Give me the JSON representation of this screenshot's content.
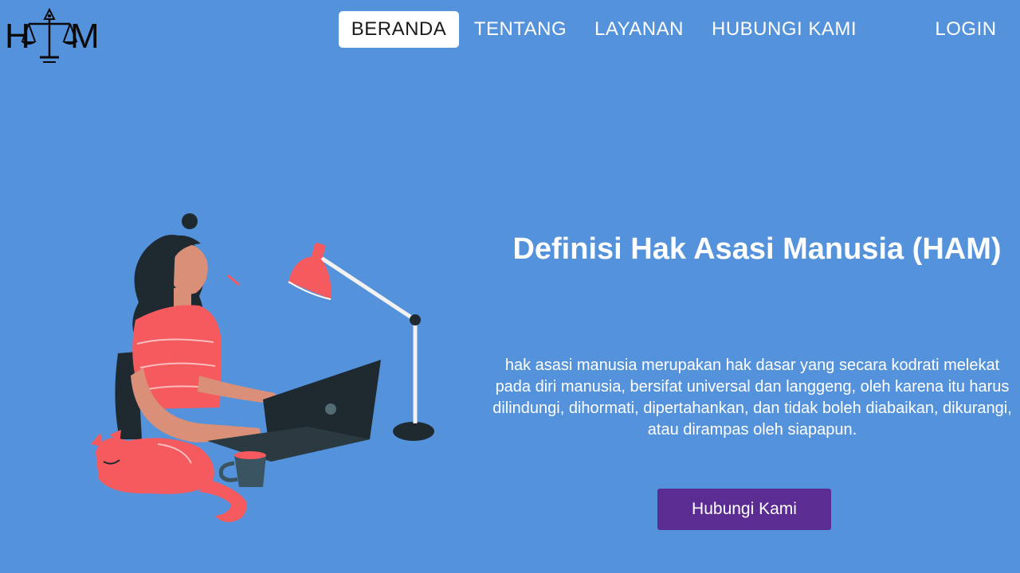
{
  "logo": {
    "text_left": "H",
    "text_right": "M",
    "icon": "scales-of-justice-icon"
  },
  "nav": {
    "items": [
      {
        "label": "BERANDA",
        "active": true
      },
      {
        "label": "TENTANG",
        "active": false
      },
      {
        "label": "LAYANAN",
        "active": false
      },
      {
        "label": "HUBUNGI KAMI",
        "active": false
      }
    ],
    "login_label": "LOGIN"
  },
  "hero": {
    "title": "Definisi Hak Asasi Manusia (HAM)",
    "description": "hak asasi manusia merupakan hak dasar yang secara kodrati melekat pada diri manusia, bersifat universal dan langgeng, oleh karena itu harus dilindungi, dihormati, dipertahankan, dan tidak boleh diabaikan, dikurangi, atau dirampas oleh siapapun.",
    "cta_label": "Hubungi Kami",
    "illustration": "woman-working-on-laptop-illustration"
  },
  "colors": {
    "background": "#5492dc",
    "active_nav_bg": "#ffffff",
    "cta_bg": "#5b2c91",
    "text": "#ffffff",
    "illustration_red": "#f55a5e",
    "illustration_dark": "#1f2a30"
  }
}
